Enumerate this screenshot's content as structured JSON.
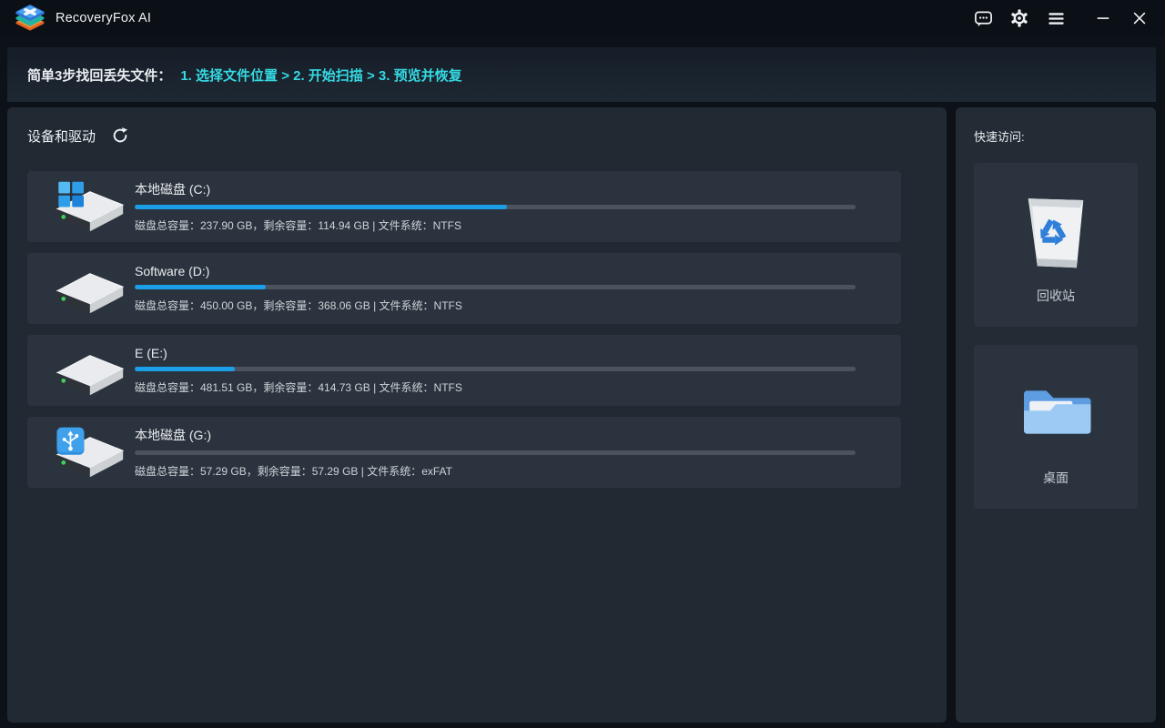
{
  "titlebar": {
    "app_title": "RecoveryFox AI",
    "icons": [
      "feedback-icon",
      "settings-gear-icon",
      "menu-icon",
      "minimize-icon",
      "close-icon"
    ]
  },
  "banner": {
    "prefix": "简单3步找回丢失文件：",
    "steps": "1. 选择文件位置 > 2. 开始扫描 > 3. 预览并恢复"
  },
  "main": {
    "header": "设备和驱动",
    "refresh_icon": "refresh-icon",
    "drives": [
      {
        "name": "本地磁盘 (C:)",
        "details": "磁盘总容量：237.90 GB，剩余容量：114.94 GB | 文件系统：NTFS",
        "total_gb": 237.9,
        "free_gb": 114.94,
        "filesystem": "NTFS",
        "used_percent": 51.7,
        "icon": "windows-drive"
      },
      {
        "name": "Software (D:)",
        "details": "磁盘总容量：450.00 GB，剩余容量：368.06 GB | 文件系统：NTFS",
        "total_gb": 450.0,
        "free_gb": 368.06,
        "filesystem": "NTFS",
        "used_percent": 18.2,
        "icon": "plain-drive"
      },
      {
        "name": "E (E:)",
        "details": "磁盘总容量：481.51 GB，剩余容量：414.73 GB | 文件系统：NTFS",
        "total_gb": 481.51,
        "free_gb": 414.73,
        "filesystem": "NTFS",
        "used_percent": 13.9,
        "icon": "plain-drive"
      },
      {
        "name": "本地磁盘 (G:)",
        "details": "磁盘总容量：57.29 GB，剩余容量：57.29 GB | 文件系统：exFAT",
        "total_gb": 57.29,
        "free_gb": 57.29,
        "filesystem": "exFAT",
        "used_percent": 0,
        "icon": "usb-drive"
      }
    ]
  },
  "sidebar": {
    "header": "快速访问:",
    "items": [
      {
        "label": "回收站",
        "icon": "recycle-bin-icon"
      },
      {
        "label": "桌面",
        "icon": "desktop-folder-icon"
      }
    ]
  },
  "colors": {
    "accent_blue": "#1b9fe8",
    "accent_cyan": "#35d9e2",
    "progress_track": "#4b545e",
    "panel_bg": "#212a33",
    "row_bg": "#2b343e",
    "titlebar_bg": "#0b1016"
  }
}
